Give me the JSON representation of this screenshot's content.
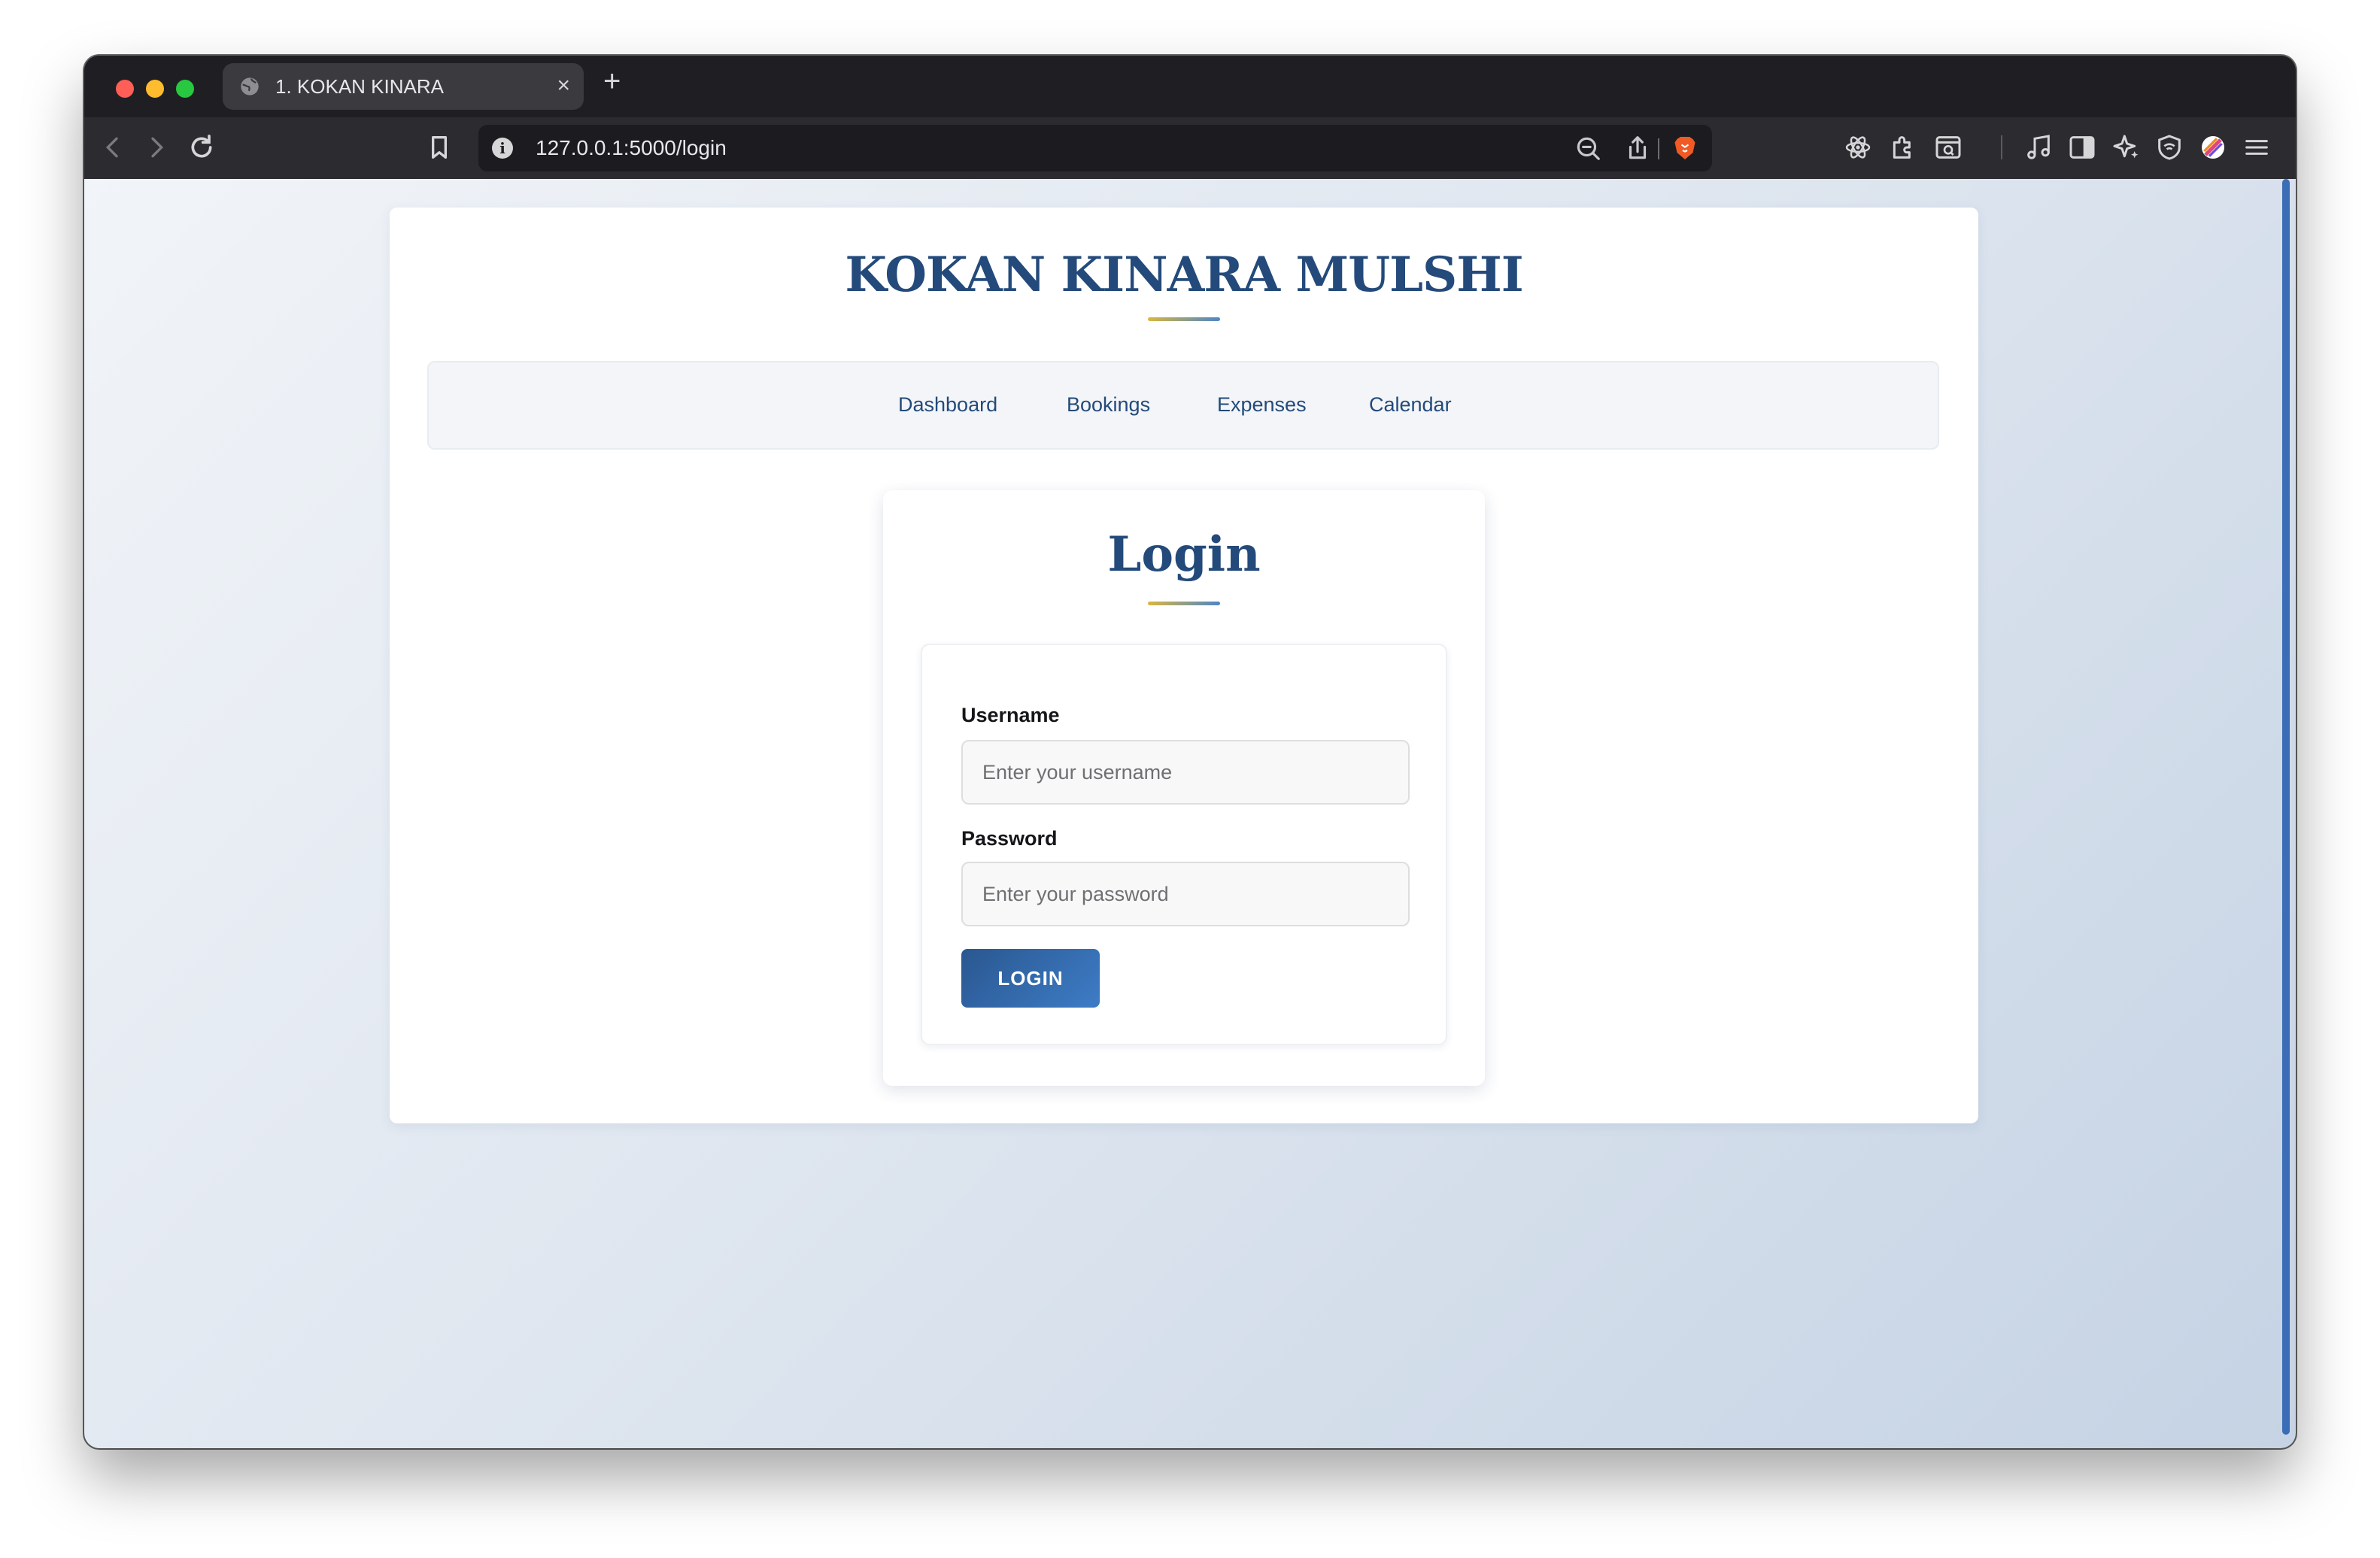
{
  "browser": {
    "tab_title": "1. KOKAN KINARA",
    "url": "127.0.0.1:5000/login"
  },
  "site": {
    "title": "KOKAN KINARA MULSHI"
  },
  "nav": {
    "items": [
      {
        "label": "Dashboard"
      },
      {
        "label": "Bookings"
      },
      {
        "label": "Expenses"
      },
      {
        "label": "Calendar"
      }
    ]
  },
  "login": {
    "title": "Login",
    "username_label": "Username",
    "username_placeholder": "Enter your username",
    "password_label": "Password",
    "password_placeholder": "Enter your password",
    "submit_label": "LOGIN"
  },
  "colors": {
    "brand": "#234a7a",
    "button": "#2f67a8",
    "accent_gold": "#d9b640"
  }
}
